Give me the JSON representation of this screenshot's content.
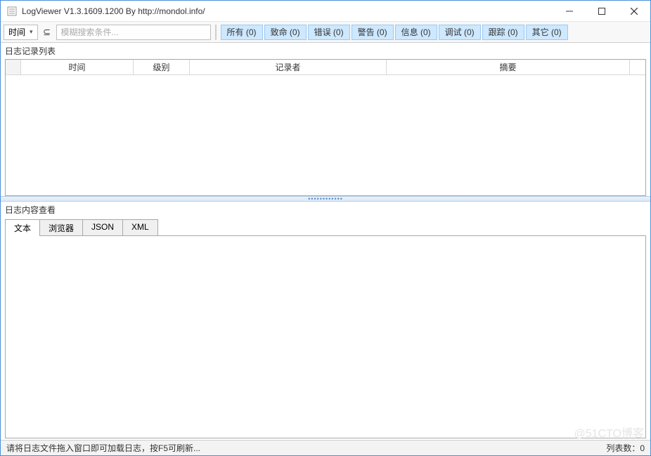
{
  "window": {
    "title": "LogViewer V1.3.1609.1200 By http://mondol.info/"
  },
  "toolbar": {
    "field_dropdown": "时间",
    "matchcase_symbol": "⊆",
    "search_placeholder": "模糊搜索条件..."
  },
  "filters": [
    {
      "label": "所有 (0)"
    },
    {
      "label": "致命 (0)"
    },
    {
      "label": "错误 (0)"
    },
    {
      "label": "警告 (0)"
    },
    {
      "label": "信息 (0)"
    },
    {
      "label": "调试 (0)"
    },
    {
      "label": "跟踪 (0)"
    },
    {
      "label": "其它 (0)"
    }
  ],
  "panels": {
    "records_title": "日志记录列表",
    "content_title": "日志内容查看"
  },
  "columns": {
    "time": "时间",
    "level": "级别",
    "logger": "记录者",
    "summary": "摘要"
  },
  "tabs": [
    {
      "label": "文本",
      "active": true
    },
    {
      "label": "浏览器",
      "active": false
    },
    {
      "label": "JSON",
      "active": false
    },
    {
      "label": "XML",
      "active": false
    }
  ],
  "statusbar": {
    "hint": "请将日志文件拖入窗口即可加载日志，按F5可刷新...",
    "count": "列表数：0"
  },
  "watermark": "@51CTO博客"
}
